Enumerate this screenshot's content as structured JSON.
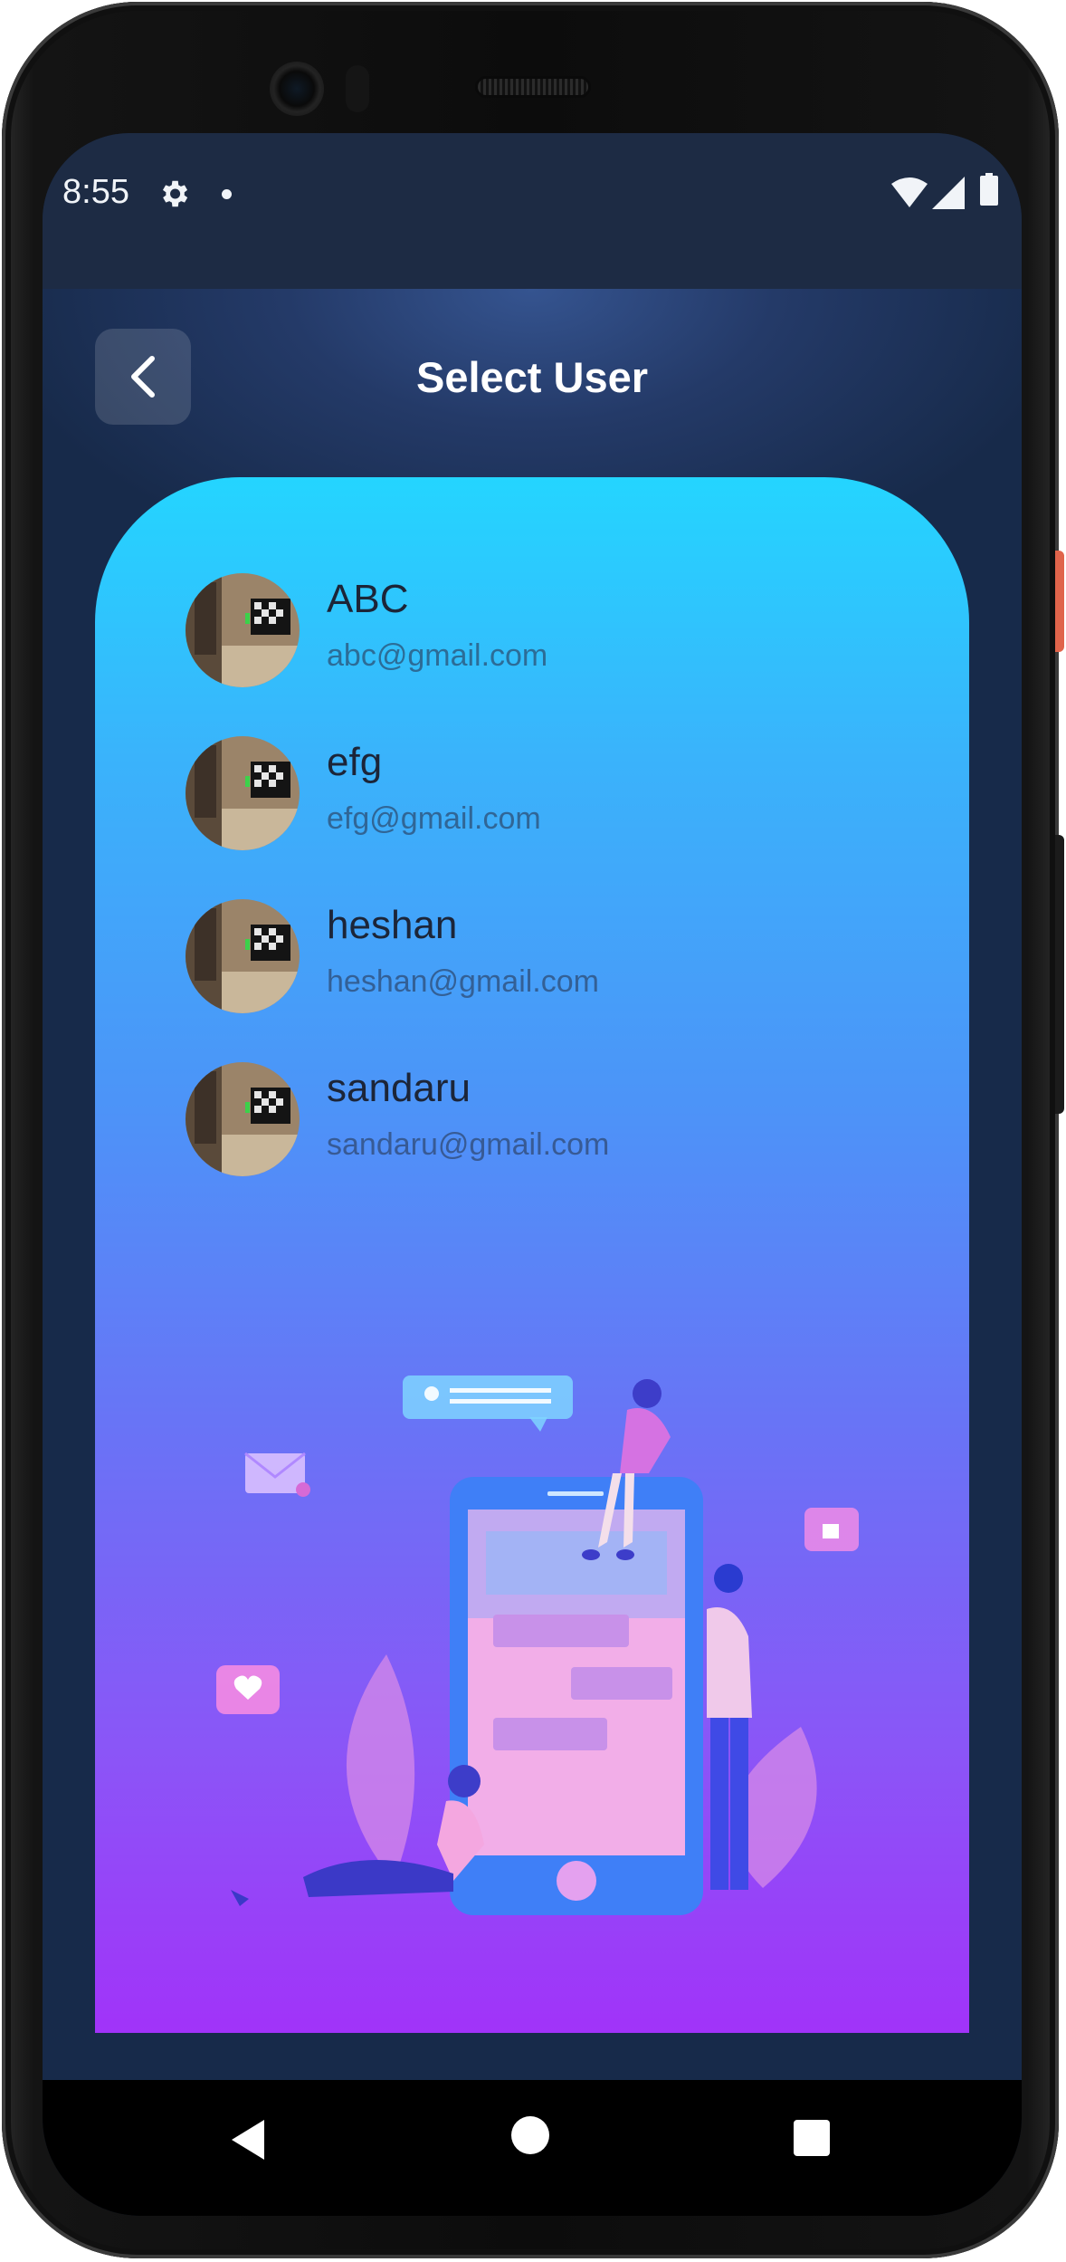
{
  "status_bar": {
    "time": "8:55"
  },
  "header": {
    "title": "Select User"
  },
  "users": [
    {
      "name": "ABC",
      "email": "abc@gmail.com"
    },
    {
      "name": "efg",
      "email": "efg@gmail.com"
    },
    {
      "name": "heshan",
      "email": "heshan@gmail.com"
    },
    {
      "name": "sandaru",
      "email": "sandaru@gmail.com"
    }
  ],
  "icons": {
    "status": [
      "gear-icon",
      "notification-dot-icon",
      "wifi-icon",
      "signal-icon",
      "battery-icon"
    ],
    "header": [
      "back-arrow-icon"
    ],
    "nav": [
      "nav-back-icon",
      "nav-home-icon",
      "nav-recents-icon"
    ]
  },
  "colors": {
    "status_bar": "#1d2b44",
    "card_top": "#24d5ff",
    "card_bottom": "#a133f9",
    "title": "#ffffff"
  }
}
